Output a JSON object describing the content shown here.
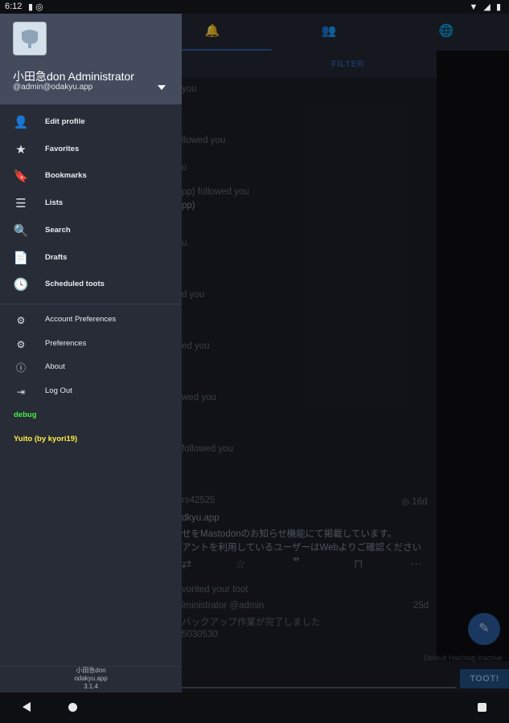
{
  "status_bar": {
    "time": "6:12",
    "left_icons": "▮ ◎",
    "right_icons": "▼ ◢ ▮"
  },
  "background": {
    "tabs": [
      {
        "name": "notifications-tab",
        "icon": "🔔"
      },
      {
        "name": "people-tab",
        "icon": "👥"
      },
      {
        "name": "globe-tab",
        "icon": "🌐"
      }
    ],
    "filter_label": "FILTER",
    "feed_lines": [
      "you",
      "llowed you",
      "o",
      "pp)   followed you",
      "pp)",
      "u",
      "d you",
      "ed you",
      "wed you",
      "followed you",
      "rs42525",
      "dkyu.app",
      "せをMastodonのお知らせ機能にて掲載しています。",
      "アントを利用しているユーザーはWebよりご確認ください",
      "vorited your toot",
      "lministrator @admin",
      "バックアップ作業が完了しました",
      "5030530"
    ],
    "post_time_1": "16d",
    "post_time_2": "25d",
    "hashtag_note": "Default Hashtag inactive",
    "toot_label": "TOOT!"
  },
  "drawer": {
    "display_name": "小田急don Administrator",
    "account": "@admin@odakyu.app",
    "items": [
      {
        "name": "edit-profile",
        "icon": "👤",
        "label": "Edit profile"
      },
      {
        "name": "favorites",
        "icon": "★",
        "label": "Favorites"
      },
      {
        "name": "bookmarks",
        "icon": "🔖",
        "label": "Bookmarks"
      },
      {
        "name": "lists",
        "icon": "☰",
        "label": "Lists"
      },
      {
        "name": "search",
        "icon": "🔍",
        "label": "Search"
      },
      {
        "name": "drafts",
        "icon": "📄",
        "label": "Drafts"
      },
      {
        "name": "scheduled-toots",
        "icon": "🕓",
        "label": "Scheduled toots"
      }
    ],
    "items2": [
      {
        "name": "account-preferences",
        "icon": "⚙",
        "label": "Account Preferences"
      },
      {
        "name": "preferences",
        "icon": "⚙",
        "label": "Preferences"
      },
      {
        "name": "about",
        "icon": "ⓘ",
        "label": "About"
      },
      {
        "name": "log-out",
        "icon": "⇥",
        "label": "Log Out"
      }
    ],
    "debug_label": "debug",
    "yuito_label": "Yuito (by kyori19)",
    "footer": {
      "instance": "小田急don",
      "domain": "odakyu.app",
      "version": "3.1.4"
    }
  },
  "colors": {
    "accent": "#2b5a9b",
    "debug": "#44ee44",
    "yuito": "#ffee44"
  }
}
